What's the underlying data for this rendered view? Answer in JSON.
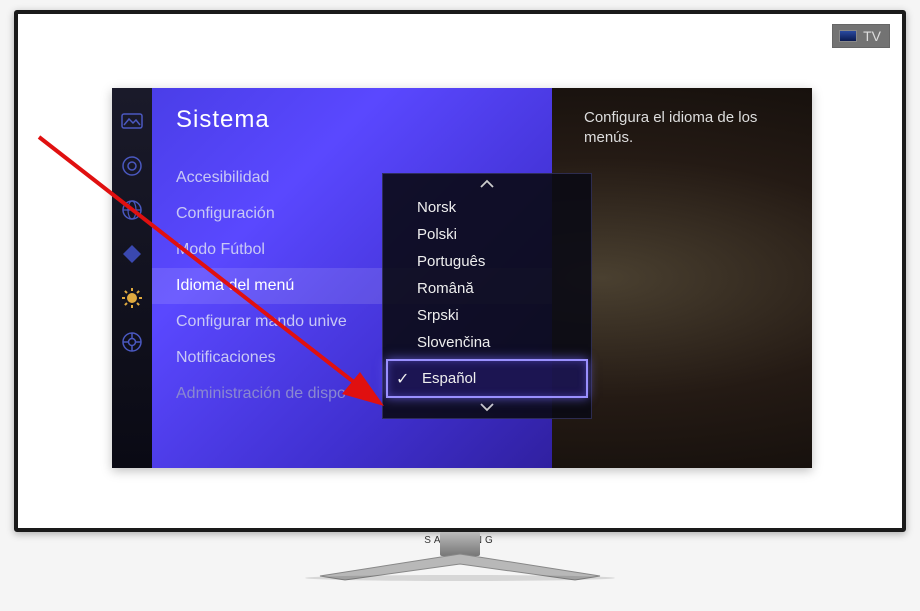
{
  "tv": {
    "brand": "SAMSUNG",
    "label": "TV"
  },
  "panel": {
    "title": "Sistema",
    "items": [
      {
        "label": "Accesibilidad"
      },
      {
        "label": "Configuración"
      },
      {
        "label": "Modo Fútbol"
      },
      {
        "label": "Idioma del menú"
      },
      {
        "label": "Configurar mando unive"
      },
      {
        "label": "Notificaciones"
      },
      {
        "label": "Administración de dispo"
      }
    ]
  },
  "description": "Configura el idioma de los menús.",
  "languages": {
    "options": [
      "Norsk",
      "Polski",
      "Português",
      "Română",
      "Srpski",
      "Slovenčina",
      "Español"
    ],
    "selected": "Español"
  },
  "icons": {
    "picture": "picture-icon",
    "sound": "sound-icon",
    "network": "network-icon",
    "smarthub": "smarthub-icon",
    "system": "system-icon",
    "support": "support-icon"
  }
}
